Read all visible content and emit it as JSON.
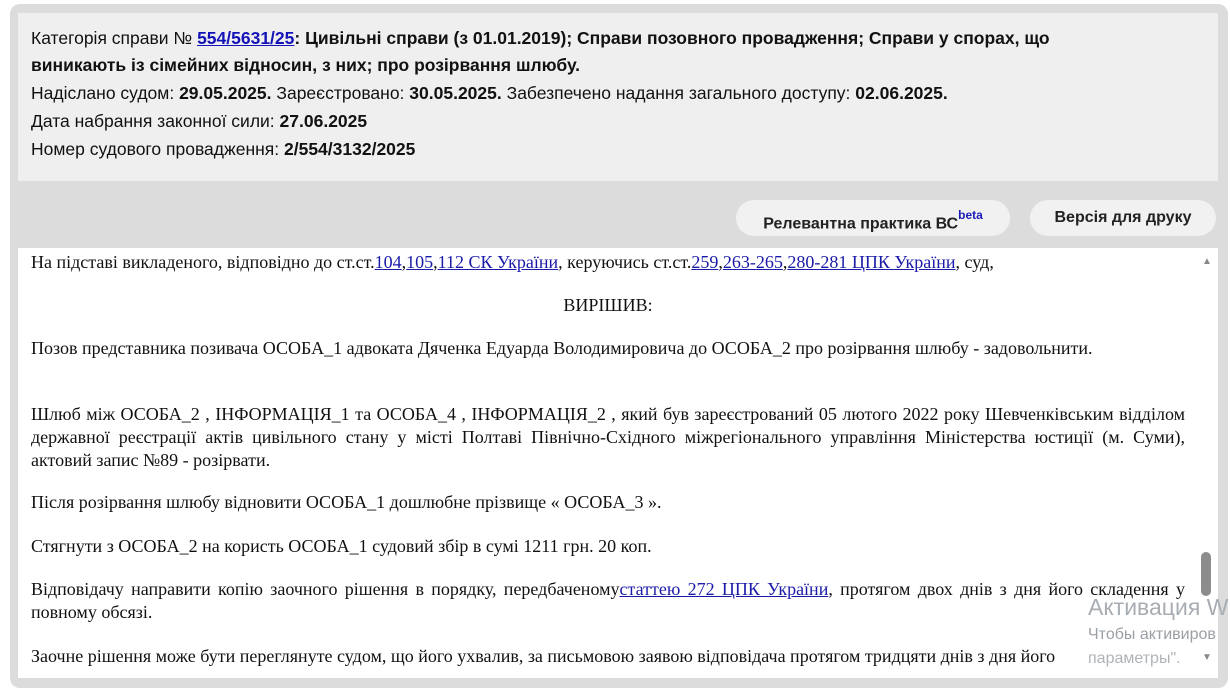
{
  "header": {
    "line1_prefix": "Категорія справи №",
    "case_number": "554/5631/25",
    "line1_rest": ": Цивільні справи (з 01.01.2019); Справи позовного провадження; Справи у спорах, що",
    "line2": "виникають із сімейних відносин, з них; про розірвання шлюбу.",
    "sent_label": "Надіслано судом:",
    "sent_date": "29.05.2025.",
    "registered_label": "Зареєстровано:",
    "registered_date": "30.05.2025.",
    "access_label": "Забезпечено надання загального доступу:",
    "access_date": "02.06.2025.",
    "effective_label": "Дата набрання законної сили:",
    "effective_date": "27.06.2025",
    "proceeding_label": "Номер судового провадження:",
    "proceeding_number": "2/554/3132/2025"
  },
  "toolbar": {
    "practice_label": "Релевантна практика ВС",
    "practice_badge": "beta",
    "print_label": "Версія для друку"
  },
  "document": {
    "p1_a": "На підставі викладеного, відповідно до ст.ст.",
    "p1_link1": "104",
    "p1_comma1": ",",
    "p1_link2": "105",
    "p1_comma2": ",",
    "p1_link3": "112 СК України",
    "p1_b": ", керуючись ст.ст.",
    "p1_link4": "259",
    "p1_comma3": ",",
    "p1_link5": "263-265",
    "p1_comma4": ",",
    "p1_link6": "280-281 ЦПК України",
    "p1_c": ", суд,",
    "heading": "ВИРІШИВ:",
    "p2": "Позов представника позивача ОСОБА_1 адвоката Дяченка Едуарда Володимировича до ОСОБА_2 про розірвання шлюбу - задовольнити.",
    "p3": "Шлюб між ОСОБА_2 , ІНФОРМАЦІЯ_1 та ОСОБА_4 , ІНФОРМАЦІЯ_2 , який був зареєстрований 05 лютого 2022 року Шевченківським відділом державної реєстрації актів цивільного стану у місті Полтаві Північно-Східного міжрегіонального управління Міністерства юстиції (м. Суми), актовий запис №89 - розірвати.",
    "p4": "Після розірвання шлюбу відновити ОСОБА_1 дошлюбне прізвище « ОСОБА_3 ».",
    "p5": "Стягнути з ОСОБА_2 на користь ОСОБА_1 судовий збір в сумі 1211 грн. 20 коп.",
    "p6_a": "Відповідачу направити копію заочного рішення в порядку, передбаченому",
    "p6_link": "статтею 272 ЦПК України",
    "p6_b": ", протягом двох днів з дня його складення у повному обсязі.",
    "p7": "Заочне рішення може бути переглянуте судом, що його ухвалив, за письмовою заявою відповідача протягом тридцяти днів з дня його"
  },
  "watermark": {
    "line1": "Активация W",
    "line2": "Чтобы активиров",
    "line3": "параметры\"."
  },
  "colors": {
    "link": "#1a1aa8",
    "panel": "#efefef",
    "frame": "#dcdcdc",
    "badge": "#1a1ab8"
  }
}
